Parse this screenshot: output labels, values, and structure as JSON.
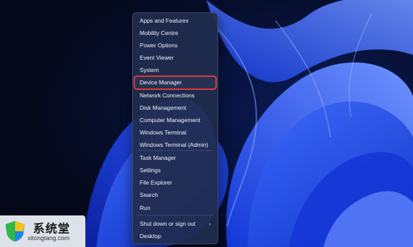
{
  "menu": {
    "items": [
      {
        "label": "Apps and Features"
      },
      {
        "label": "Mobility Centre"
      },
      {
        "label": "Power Options"
      },
      {
        "label": "Event Viewer"
      },
      {
        "label": "System"
      },
      {
        "label": "Device Manager",
        "highlighted": true
      },
      {
        "label": "Network Connections"
      },
      {
        "label": "Disk Management"
      },
      {
        "label": "Computer Management"
      },
      {
        "label": "Windows Terminal"
      },
      {
        "label": "Windows Terminal (Admin)"
      },
      {
        "label": "Task Manager"
      },
      {
        "label": "Settings"
      },
      {
        "label": "File Explorer"
      },
      {
        "label": "Search"
      },
      {
        "label": "Run"
      },
      {
        "label": "Shut down or sign out",
        "has_submenu": true
      },
      {
        "label": "Desktop"
      }
    ],
    "submenu_glyph": "›"
  },
  "watermark": {
    "brand": "系统堂",
    "url": "xitongtang.com",
    "icon": "shield-logo-icon"
  },
  "colors": {
    "highlight_border": "#e03b3b",
    "menu_background": "#202c4e",
    "wallpaper_blue": "#1f4fff"
  }
}
